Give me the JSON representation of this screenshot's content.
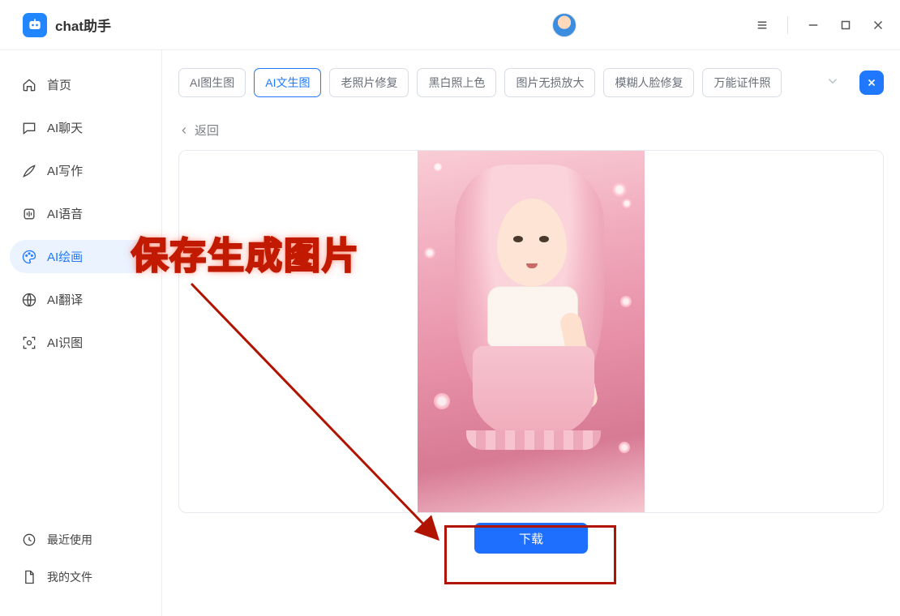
{
  "app": {
    "title": "chat助手"
  },
  "sidebar": {
    "items": [
      {
        "label": "首页"
      },
      {
        "label": "AI聊天"
      },
      {
        "label": "AI写作"
      },
      {
        "label": "AI语音"
      },
      {
        "label": "AI绘画"
      },
      {
        "label": "AI翻译"
      },
      {
        "label": "AI识图"
      }
    ],
    "bottom": [
      {
        "label": "最近使用"
      },
      {
        "label": "我的文件"
      }
    ]
  },
  "tabs": [
    {
      "label": "AI图生图"
    },
    {
      "label": "AI文生图"
    },
    {
      "label": "老照片修复"
    },
    {
      "label": "黑白照上色"
    },
    {
      "label": "图片无损放大"
    },
    {
      "label": "模糊人脸修复"
    },
    {
      "label": "万能证件照"
    }
  ],
  "back_label": "返回",
  "download_label": "下载",
  "annotation_text": "保存生成图片"
}
